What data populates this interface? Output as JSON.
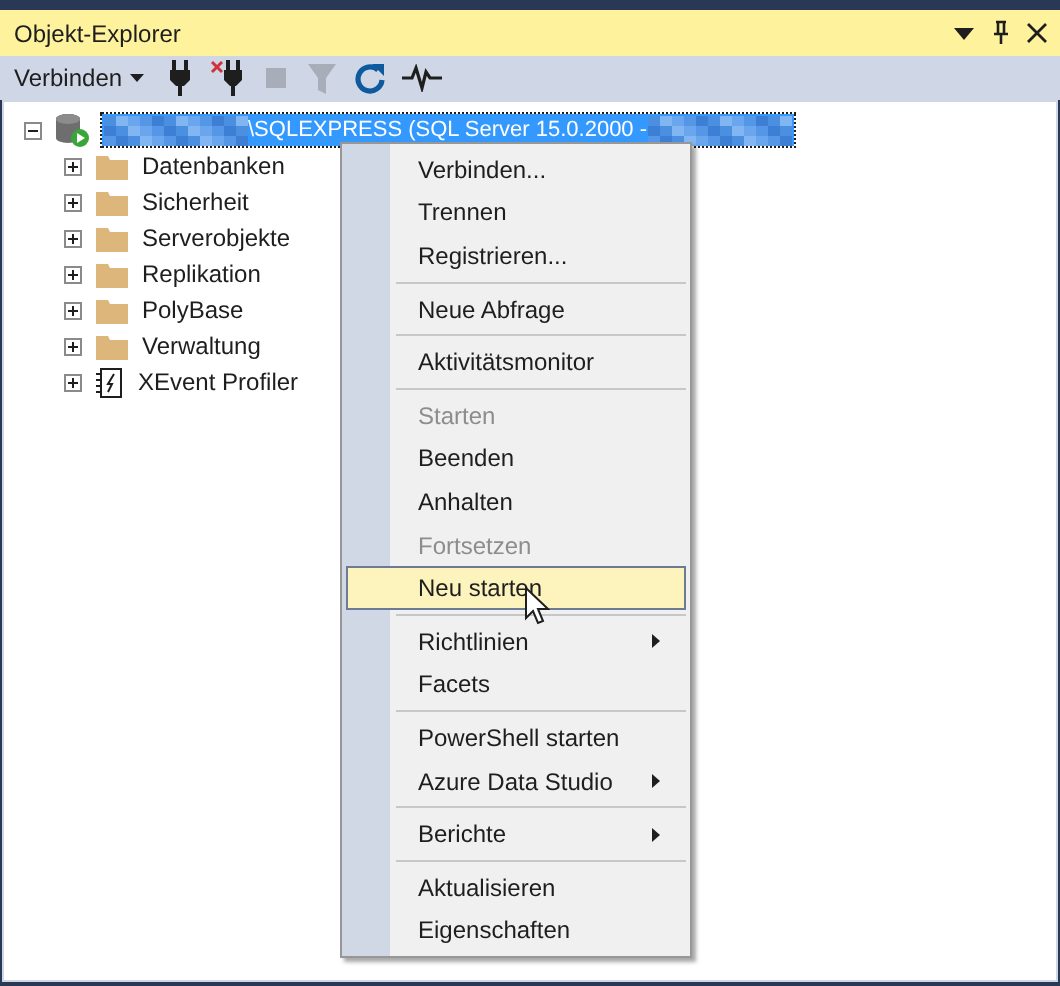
{
  "window": {
    "title": "Objekt-Explorer"
  },
  "toolbar": [
    {
      "kind": "dropdown",
      "label": "Verbinden",
      "disabled": false
    },
    {
      "kind": "plug",
      "disabled": false
    },
    {
      "kind": "unplug",
      "disabled": false
    },
    {
      "kind": "stop",
      "disabled": true
    },
    {
      "kind": "filter",
      "disabled": true
    },
    {
      "kind": "refresh",
      "disabled": false
    },
    {
      "kind": "activity",
      "disabled": false
    }
  ],
  "tree": [
    {
      "kind": "server",
      "label": "\\SQLEXPRESS (SQL Server 15.0.2000 -",
      "selected": true,
      "expanded": true,
      "children": [
        {
          "kind": "folder",
          "label": "Datenbanken",
          "expanded": false
        },
        {
          "kind": "folder",
          "label": "Sicherheit",
          "expanded": false
        },
        {
          "kind": "folder",
          "label": "Serverobjekte",
          "expanded": false
        },
        {
          "kind": "folder",
          "label": "Replikation",
          "expanded": false
        },
        {
          "kind": "folder",
          "label": "PolyBase",
          "expanded": false
        },
        {
          "kind": "folder",
          "label": "Verwaltung",
          "expanded": false
        },
        {
          "kind": "profiler",
          "label": "XEvent Profiler",
          "expanded": false
        }
      ]
    }
  ],
  "context_menu": [
    {
      "kind": "item",
      "label": "Verbinden...",
      "disabled": false,
      "selected": false,
      "submenu": false
    },
    {
      "kind": "item",
      "label": "Trennen",
      "disabled": false,
      "selected": false,
      "submenu": false
    },
    {
      "kind": "item",
      "label": "Registrieren...",
      "disabled": false,
      "selected": false,
      "submenu": false
    },
    {
      "kind": "separator"
    },
    {
      "kind": "item",
      "label": "Neue Abfrage",
      "disabled": false,
      "selected": false,
      "submenu": false
    },
    {
      "kind": "separator"
    },
    {
      "kind": "item",
      "label": "Aktivitätsmonitor",
      "disabled": false,
      "selected": false,
      "submenu": false
    },
    {
      "kind": "separator"
    },
    {
      "kind": "item",
      "label": "Starten",
      "disabled": true,
      "selected": false,
      "submenu": false
    },
    {
      "kind": "item",
      "label": "Beenden",
      "disabled": false,
      "selected": false,
      "submenu": false
    },
    {
      "kind": "item",
      "label": "Anhalten",
      "disabled": false,
      "selected": false,
      "submenu": false
    },
    {
      "kind": "item",
      "label": "Fortsetzen",
      "disabled": true,
      "selected": false,
      "submenu": false
    },
    {
      "kind": "item",
      "label": "Neu starten",
      "disabled": false,
      "selected": true,
      "submenu": false
    },
    {
      "kind": "separator"
    },
    {
      "kind": "item",
      "label": "Richtlinien",
      "disabled": false,
      "selected": false,
      "submenu": true
    },
    {
      "kind": "item",
      "label": "Facets",
      "disabled": false,
      "selected": false,
      "submenu": false
    },
    {
      "kind": "separator"
    },
    {
      "kind": "item",
      "label": "PowerShell starten",
      "disabled": false,
      "selected": false,
      "submenu": false
    },
    {
      "kind": "item",
      "label": "Azure Data Studio",
      "disabled": false,
      "selected": false,
      "submenu": true
    },
    {
      "kind": "separator"
    },
    {
      "kind": "item",
      "label": "Berichte",
      "disabled": false,
      "selected": false,
      "submenu": true
    },
    {
      "kind": "separator"
    },
    {
      "kind": "item",
      "label": "Aktualisieren",
      "disabled": false,
      "selected": false,
      "submenu": false
    },
    {
      "kind": "item",
      "label": "Eigenschaften",
      "disabled": false,
      "selected": false,
      "submenu": false
    }
  ]
}
